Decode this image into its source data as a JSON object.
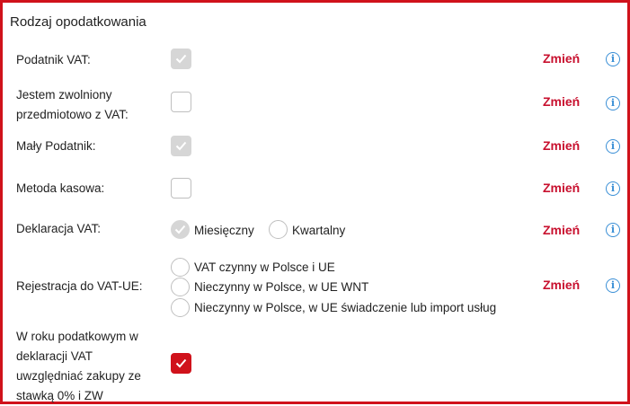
{
  "section_title": "Rodzaj opodatkowania",
  "change_label": "Zmień",
  "info_symbol": "i",
  "accent_color": "#d0121b",
  "info_color": "#3a8fd6",
  "rows": {
    "vat_payer": {
      "label": "Podatnik VAT:",
      "checked": true,
      "disabled": true
    },
    "exempt": {
      "label_line1": "Jestem zwolniony",
      "label_line2": "przedmiotowo z VAT:",
      "checked": false
    },
    "small_taxpayer": {
      "label": "Mały Podatnik:",
      "checked": true,
      "disabled": true
    },
    "cash_method": {
      "label": "Metoda kasowa:",
      "checked": false
    },
    "vat_declaration": {
      "label": "Deklaracja VAT:",
      "options": [
        "Miesięczny",
        "Kwartalny"
      ],
      "selected": "Miesięczny"
    },
    "vat_ue": {
      "label": "Rejestracja do VAT-UE:",
      "options": [
        "VAT czynny w Polsce i UE",
        "Nieczynny w Polsce, w UE WNT",
        "Nieczynny w Polsce, w UE świadczenie lub import usług"
      ],
      "selected": null
    },
    "purchases": {
      "label_lines": [
        "W roku podatkowym w",
        "deklaracji VAT",
        "uwzględniać zakupy ze",
        "stawką 0% i ZW"
      ],
      "checked": true
    }
  }
}
